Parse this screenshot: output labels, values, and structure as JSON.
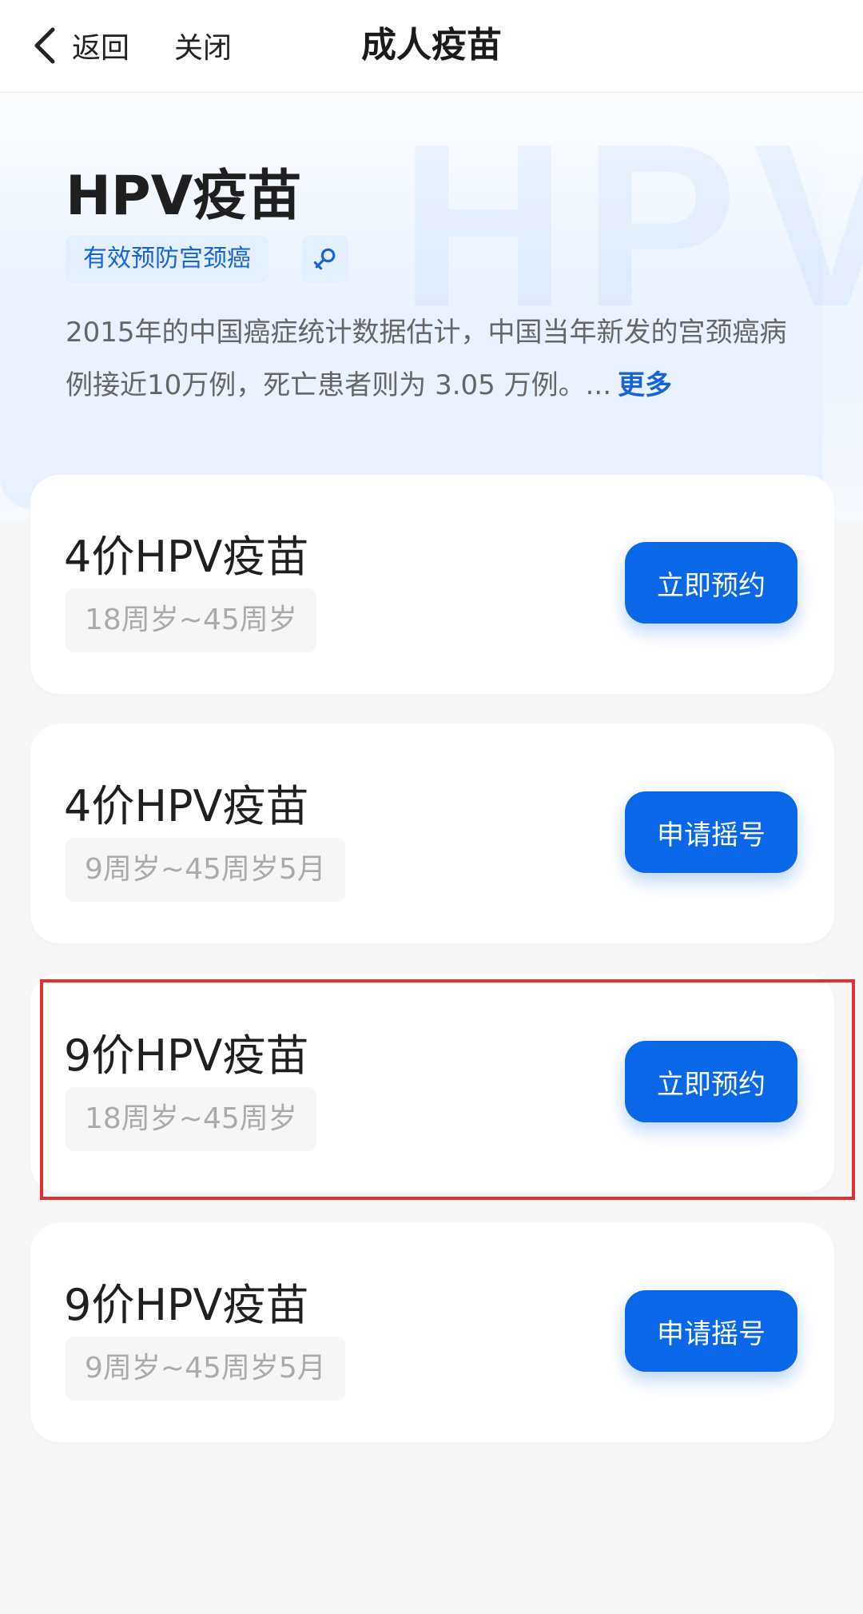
{
  "header": {
    "back_label": "返回",
    "close_label": "关闭",
    "title": "成人疫苗"
  },
  "hero": {
    "title": "HPV疫苗",
    "tag": "有效预防宫颈癌",
    "tag_icon": "female-symbol-icon",
    "watermark": "HPV",
    "description": "2015年的中国癌症统计数据估计，中国当年新发的宫颈癌病例接近10万例，死亡患者则为 3.05 万例。...",
    "more_label": "更多"
  },
  "vaccines": [
    {
      "title": "4价HPV疫苗",
      "age": "18周岁~45周岁",
      "button": "立即预约"
    },
    {
      "title": "4价HPV疫苗",
      "age": "9周岁~45周岁5月",
      "button": "申请摇号"
    },
    {
      "title": "9价HPV疫苗",
      "age": "18周岁~45周岁",
      "button": "立即预约"
    },
    {
      "title": "9价HPV疫苗",
      "age": "9周岁~45周岁5月",
      "button": "申请摇号"
    }
  ],
  "colors": {
    "accent": "#0a67e8",
    "highlight": "#e03131"
  }
}
